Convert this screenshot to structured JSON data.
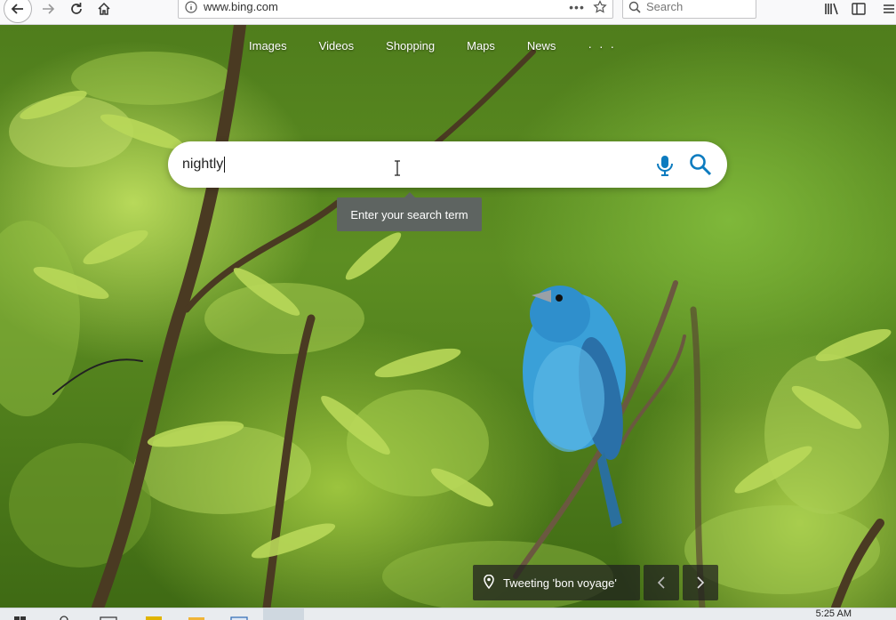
{
  "browser": {
    "url": "www.bing.com",
    "search_placeholder": "Search",
    "url_more": "•••"
  },
  "nav": {
    "items": [
      "Images",
      "Videos",
      "Shopping",
      "Maps",
      "News"
    ],
    "more": "· · ·"
  },
  "search": {
    "query": "nightly",
    "tooltip": "Enter your search term"
  },
  "caption": {
    "text": "Tweeting 'bon voyage'"
  },
  "taskbar": {
    "clock": "5:25 AM"
  },
  "colors": {
    "bing_blue": "#0c7bbf",
    "tooltip_bg": "#5e6461"
  }
}
